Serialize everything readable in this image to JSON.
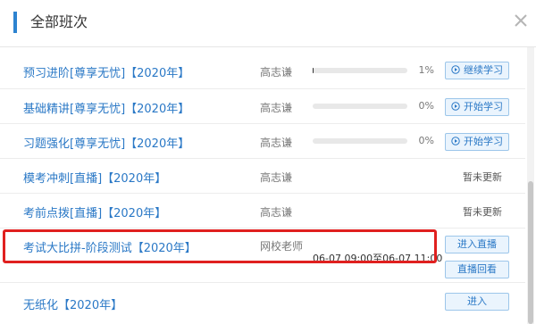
{
  "dialog": {
    "title": "全部班次",
    "close_icon": "close-icon"
  },
  "courses": [
    {
      "name": "预习进阶[尊享无忧]【2020年】",
      "teacher": "高志谦",
      "progress": 1,
      "percent": "1%",
      "action": "继续学习",
      "icon": "play-circle-icon"
    },
    {
      "name": "基础精讲[尊享无忧]【2020年】",
      "teacher": "高志谦",
      "progress": 0,
      "percent": "0%",
      "action": "开始学习",
      "icon": "play-circle-icon"
    },
    {
      "name": "习题强化[尊享无忧]【2020年】",
      "teacher": "高志谦",
      "progress": 0,
      "percent": "0%",
      "action": "开始学习",
      "icon": "play-circle-icon"
    },
    {
      "name": "模考冲刺[直播]【2020年】",
      "teacher": "高志谦",
      "status": "暂未更新"
    },
    {
      "name": "考前点拨[直播]【2020年】",
      "teacher": "高志谦",
      "status": "暂未更新"
    },
    {
      "name": "考试大比拼-阶段测试【2020年】",
      "teacher": "网校老师",
      "time": "06-07 09:00至06-07 11:00",
      "action_live": "进入直播",
      "action_replay": "直播回看"
    },
    {
      "name": "无纸化【2020年】",
      "action": "进入"
    }
  ],
  "colors": {
    "accent": "#2d83d0",
    "link": "#2a78c6",
    "highlight": "#e0201f"
  }
}
